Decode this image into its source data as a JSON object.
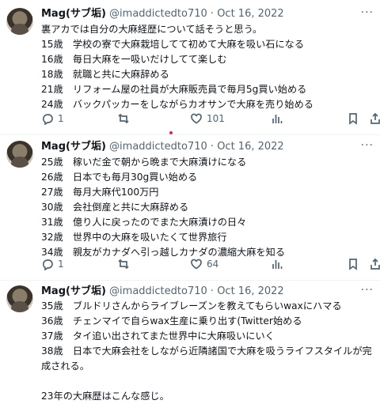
{
  "tweets": [
    {
      "name": "Mag(サブ垢)",
      "handle": "@imaddictedto710",
      "date": "Oct 16, 2022",
      "more": "···",
      "lines": [
        "裏アカでは自分の大麻経歴について話そうと思う。",
        "15歳　学校の寮で大麻栽培してて初めて大麻を吸い石になる",
        "16歳　毎日大麻を一吸いだけしてて楽しむ",
        "18歳　就職と共に大麻辞める",
        "21歳　リフォーム屋の社員が大麻販売員で毎月5g買い始める",
        "24歳　バックパッカーをしながらカオサンで大麻を売り始める"
      ],
      "replies": "1",
      "retweets": "",
      "likes": "101"
    },
    {
      "name": "Mag(サブ垢)",
      "handle": "@imaddictedto710",
      "date": "Oct 16, 2022",
      "more": "···",
      "lines": [
        "25歳　稼いだ金で朝から晩まで大麻漬けになる",
        "26歳　日本でも毎月30g買い始める",
        "27歳　毎月大麻代100万円",
        "30歳　会社倒産と共に大麻辞める",
        "31歳　億り人に戻ったのでまた大麻漬けの日々",
        "32歳　世界中の大麻を吸いたくて世界旅行",
        "34歳　親友がカナダへ引っ越しカナダの濃縮大麻を知る"
      ],
      "replies": "1",
      "retweets": "",
      "likes": "64"
    },
    {
      "name": "Mag(サブ垢)",
      "handle": "@imaddictedto710",
      "date": "Oct 16, 2022",
      "more": "···",
      "lines": [
        "35歳　ブルドリさんからライブレーズンを教えてもらいwaxにハマる",
        "36歳　チェンマイで自らwax生産に乗り出す(Twitter始める",
        "37歳　タイ追い出されてまた世界中に大麻吸いにいく",
        "38歳　日本で大麻会社をしながら近隣諸国で大麻を吸うライフスタイルが完",
        "成される。",
        "",
        "23年の大麻歴はこんな感じ。"
      ]
    }
  ],
  "separator": "·",
  "colors": {
    "text": "#0f1419",
    "secondary": "#536471",
    "divider": "#eff3f4"
  }
}
